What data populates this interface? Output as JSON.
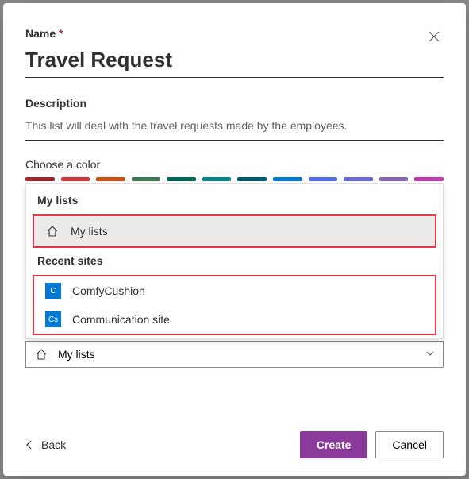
{
  "labels": {
    "name": "Name",
    "description": "Description",
    "chooseColor": "Choose a color"
  },
  "nameValue": "Travel Request",
  "descValue": "This list will deal with the travel requests made by the employees.",
  "colors": [
    "#a4262c",
    "#d13438",
    "#ca5010",
    "#407855",
    "#006b57",
    "#038387",
    "#005b70",
    "#0078d4",
    "#4f6bed",
    "#6b69d6",
    "#8764b8",
    "#c239b3"
  ],
  "dropdown": {
    "group1": "My lists",
    "myLists": "My lists",
    "group2": "Recent sites",
    "site1Tag": "C",
    "site1": "ComfyCushion",
    "site2Tag": "Cs",
    "site2": "Communication site"
  },
  "saveSelected": "My lists",
  "footer": {
    "back": "Back",
    "create": "Create",
    "cancel": "Cancel"
  }
}
